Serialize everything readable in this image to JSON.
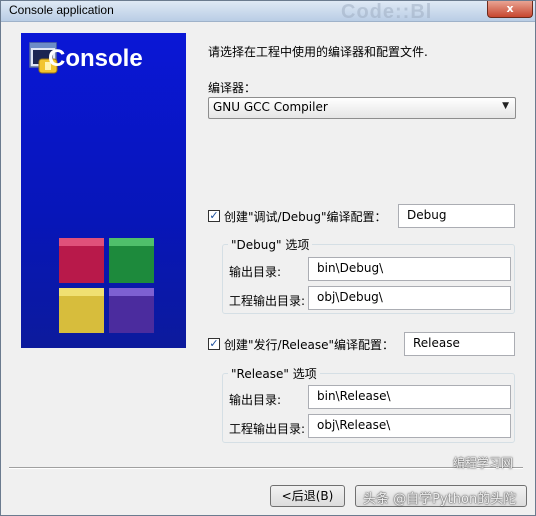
{
  "window": {
    "title": "Console application",
    "title_watermark": "Code::Bl",
    "close_glyph": "x"
  },
  "side_panel": {
    "logo_text": "Console"
  },
  "main": {
    "instructions": "请选择在工程中使用的编译器和配置文件.",
    "compiler_label": "编译器：",
    "compiler_value": "GNU GCC Compiler",
    "debug": {
      "checkbox_label": "创建\"调试/Debug\"编译配置：",
      "checked": true,
      "config_name": "Debug",
      "group_title": "\"Debug\" 选项",
      "output_dir_label": "输出目录:",
      "output_dir_value": "bin\\Debug\\",
      "obj_dir_label": "工程输出目录:",
      "obj_dir_value": "obj\\Debug\\"
    },
    "release": {
      "checkbox_label": "创建\"发行/Release\"编译配置：",
      "checked": true,
      "config_name": "Release",
      "group_title": "\"Release\" 选项",
      "output_dir_label": "输出目录:",
      "output_dir_value": "bin\\Release\\",
      "obj_dir_label": "工程输出目录:",
      "obj_dir_value": "obj\\Release\\"
    }
  },
  "buttons": {
    "back_label": "<后退(B)"
  },
  "watermarks": {
    "top_right": "编程学习网",
    "bottom": "头条 @自学Python的头陀"
  }
}
